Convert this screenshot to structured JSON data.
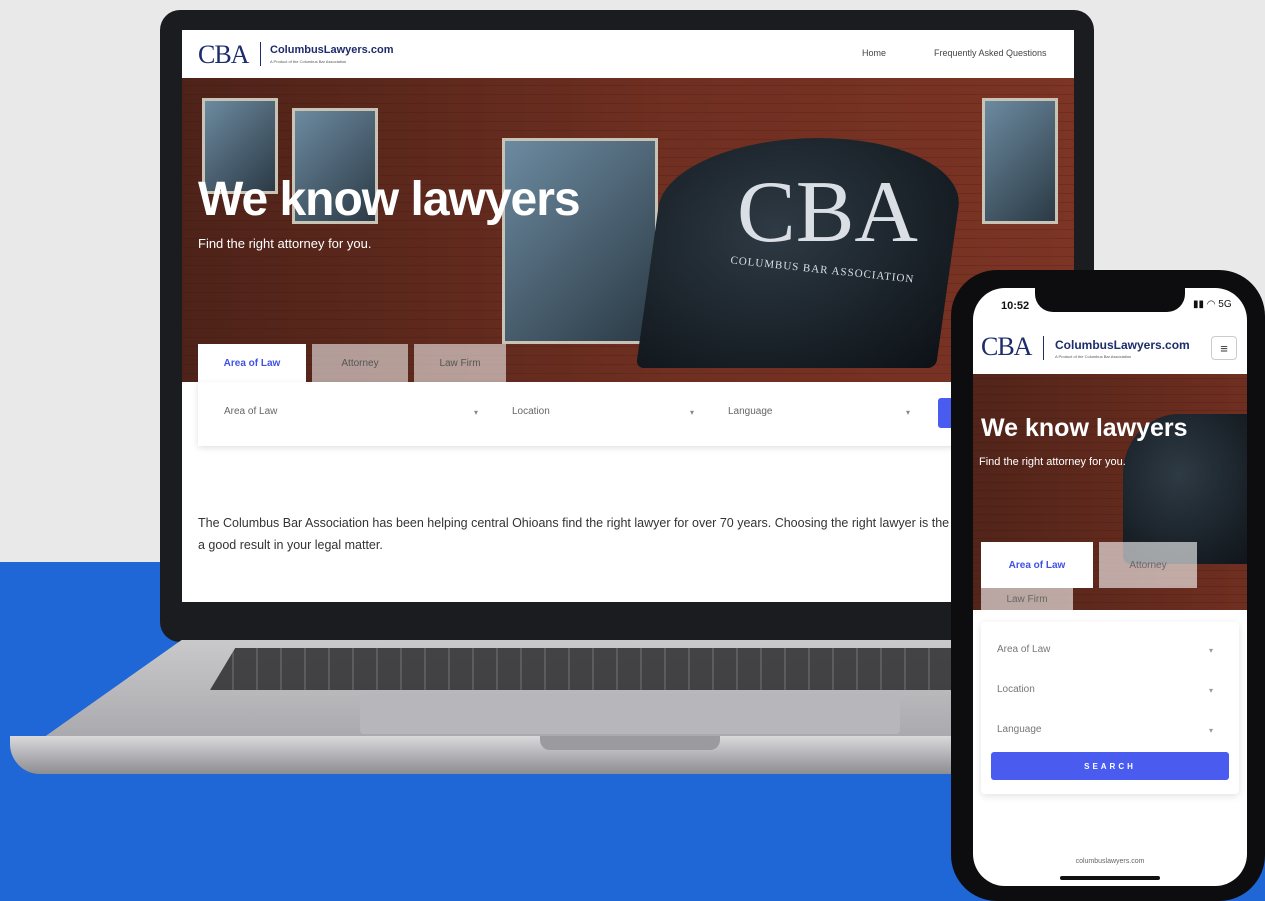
{
  "desktop": {
    "logo": "CBA",
    "brand": "ColumbusLawyers.com",
    "brand_sub": "A Product of the Columbus Bar Association",
    "nav": {
      "home": "Home",
      "faq": "Frequently Asked Questions"
    },
    "hero": {
      "title": "We know lawyers",
      "subtitle": "Find the right attorney for you.",
      "sign_logo": "CBA",
      "sign_text": "COLUMBUS BAR ASSOCIATION"
    },
    "tabs": [
      "Area of Law",
      "Attorney",
      "Law Firm"
    ],
    "search": {
      "area_label": "Area of Law",
      "location_label": "Location",
      "language_label": "Language"
    },
    "intro": "The Columbus Bar Association has been helping central Ohioans find the right lawyer for over 70 years. Choosing the right lawyer is the first step in getting a good result in your legal matter."
  },
  "mobile": {
    "time": "10:52",
    "status": "▮▮ ◠ 5G",
    "logo": "CBA",
    "brand": "ColumbusLawyers.com",
    "brand_sub": "A Product of the Columbus Bar Association",
    "menu_icon": "≡",
    "hero": {
      "title": "We know lawyers",
      "subtitle": "Find the right attorney for you."
    },
    "tabs": [
      "Area of Law",
      "Attorney",
      "Law Firm"
    ],
    "fields": [
      "Area of Law",
      "Location",
      "Language"
    ],
    "search_button": "SEARCH",
    "url": "columbuslawyers.com"
  },
  "colors": {
    "accent": "#4a5cf0",
    "brand_navy": "#1d2c6b",
    "background_blue": "#1f66d6"
  },
  "icons": {
    "caret": "▾",
    "hamburger": "menu-icon"
  }
}
